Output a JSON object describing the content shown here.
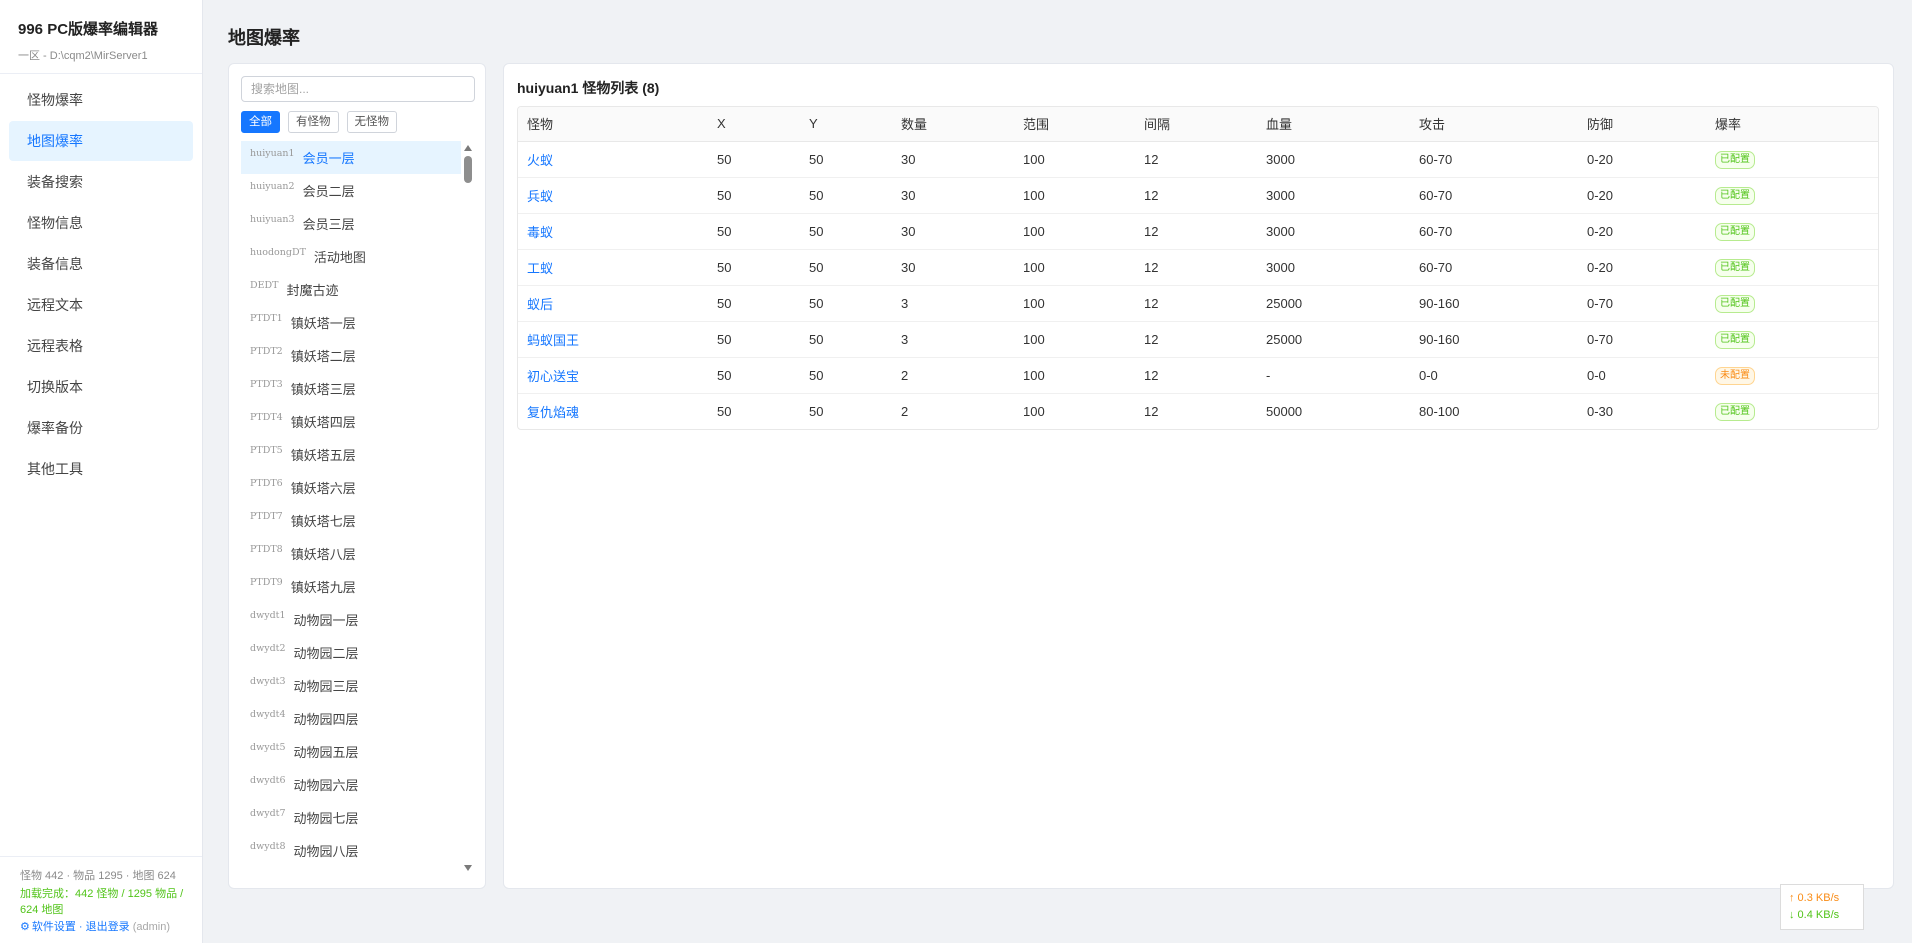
{
  "app": {
    "title": "996 PC版爆率编辑器",
    "path": "一区 - D:\\cqm2\\MirServer1"
  },
  "nav": [
    {
      "label": "怪物爆率",
      "active": false
    },
    {
      "label": "地图爆率",
      "active": true
    },
    {
      "label": "装备搜索",
      "active": false
    },
    {
      "label": "怪物信息",
      "active": false
    },
    {
      "label": "装备信息",
      "active": false
    },
    {
      "label": "远程文本",
      "active": false
    },
    {
      "label": "远程表格",
      "active": false
    },
    {
      "label": "切换版本",
      "active": false
    },
    {
      "label": "爆率备份",
      "active": false
    },
    {
      "label": "其他工具",
      "active": false
    }
  ],
  "footer": {
    "stats": "怪物 442 · 物品 1295 · 地图 624",
    "load_status": "加载完成：442 怪物 / 1295 物品 / 624 地图",
    "settings_label": "软件设置",
    "separator": " · ",
    "logout_label": "退出登录",
    "user": " (admin)"
  },
  "page": {
    "title": "地图爆率"
  },
  "map_panel": {
    "search_placeholder": "搜索地图...",
    "filters": [
      {
        "label": "全部",
        "active": true
      },
      {
        "label": "有怪物",
        "active": false
      },
      {
        "label": "无怪物",
        "active": false
      }
    ],
    "maps": [
      {
        "code": "huiyuan1",
        "name": "会员一层",
        "active": true
      },
      {
        "code": "huiyuan2",
        "name": "会员二层"
      },
      {
        "code": "huiyuan3",
        "name": "会员三层"
      },
      {
        "code": "huodongDT",
        "name": "活动地图"
      },
      {
        "code": "DEDT",
        "name": "封魔古迹"
      },
      {
        "code": "PTDT1",
        "name": "镇妖塔一层"
      },
      {
        "code": "PTDT2",
        "name": "镇妖塔二层"
      },
      {
        "code": "PTDT3",
        "name": "镇妖塔三层"
      },
      {
        "code": "PTDT4",
        "name": "镇妖塔四层"
      },
      {
        "code": "PTDT5",
        "name": "镇妖塔五层"
      },
      {
        "code": "PTDT6",
        "name": "镇妖塔六层"
      },
      {
        "code": "PTDT7",
        "name": "镇妖塔七层"
      },
      {
        "code": "PTDT8",
        "name": "镇妖塔八层"
      },
      {
        "code": "PTDT9",
        "name": "镇妖塔九层"
      },
      {
        "code": "dwydt1",
        "name": "动物园一层"
      },
      {
        "code": "dwydt2",
        "name": "动物园二层"
      },
      {
        "code": "dwydt3",
        "name": "动物园三层"
      },
      {
        "code": "dwydt4",
        "name": "动物园四层"
      },
      {
        "code": "dwydt5",
        "name": "动物园五层"
      },
      {
        "code": "dwydt6",
        "name": "动物园六层"
      },
      {
        "code": "dwydt7",
        "name": "动物园七层"
      },
      {
        "code": "dwydt8",
        "name": "动物园八层"
      }
    ]
  },
  "monster_panel": {
    "heading": "huiyuan1 怪物列表 (8)",
    "columns": [
      "怪物",
      "X",
      "Y",
      "数量",
      "范围",
      "间隔",
      "血量",
      "攻击",
      "防御",
      "爆率"
    ],
    "rows": [
      {
        "name": "火蚁",
        "x": "50",
        "y": "50",
        "count": "30",
        "range": "100",
        "interval": "12",
        "hp": "3000",
        "atk": "60-70",
        "def": "0-20",
        "status": "已配置",
        "configured": true
      },
      {
        "name": "兵蚁",
        "x": "50",
        "y": "50",
        "count": "30",
        "range": "100",
        "interval": "12",
        "hp": "3000",
        "atk": "60-70",
        "def": "0-20",
        "status": "已配置",
        "configured": true
      },
      {
        "name": "毒蚁",
        "x": "50",
        "y": "50",
        "count": "30",
        "range": "100",
        "interval": "12",
        "hp": "3000",
        "atk": "60-70",
        "def": "0-20",
        "status": "已配置",
        "configured": true
      },
      {
        "name": "工蚁",
        "x": "50",
        "y": "50",
        "count": "30",
        "range": "100",
        "interval": "12",
        "hp": "3000",
        "atk": "60-70",
        "def": "0-20",
        "status": "已配置",
        "configured": true
      },
      {
        "name": "蚁后",
        "x": "50",
        "y": "50",
        "count": "3",
        "range": "100",
        "interval": "12",
        "hp": "25000",
        "atk": "90-160",
        "def": "0-70",
        "status": "已配置",
        "configured": true
      },
      {
        "name": "蚂蚁国王",
        "x": "50",
        "y": "50",
        "count": "3",
        "range": "100",
        "interval": "12",
        "hp": "25000",
        "atk": "90-160",
        "def": "0-70",
        "status": "已配置",
        "configured": true
      },
      {
        "name": "初心送宝",
        "x": "50",
        "y": "50",
        "count": "2",
        "range": "100",
        "interval": "12",
        "hp": "-",
        "atk": "0-0",
        "def": "0-0",
        "status": "未配置",
        "configured": false
      },
      {
        "name": "复仇焰魂",
        "x": "50",
        "y": "50",
        "count": "2",
        "range": "100",
        "interval": "12",
        "hp": "50000",
        "atk": "80-100",
        "def": "0-30",
        "status": "已配置",
        "configured": true
      }
    ]
  },
  "network": {
    "upload": "↑ 0.3 KB/s",
    "download": "↓ 0.4 KB/s"
  },
  "colors": {
    "accent": "#1677ff",
    "success": "#52c41a",
    "warning": "#fa8c16"
  }
}
